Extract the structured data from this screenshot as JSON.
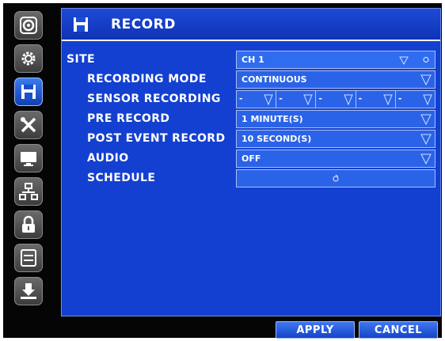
{
  "title": "RECORD",
  "sidebar": {
    "items": [
      {
        "name": "camera"
      },
      {
        "name": "gear"
      },
      {
        "name": "save"
      },
      {
        "name": "tools"
      },
      {
        "name": "monitor"
      },
      {
        "name": "network"
      },
      {
        "name": "lock"
      },
      {
        "name": "storage"
      },
      {
        "name": "download"
      }
    ],
    "active_index": 2
  },
  "form": {
    "site": {
      "label": "SITE",
      "value": "CH 1"
    },
    "recording_mode": {
      "label": "RECORDING MODE",
      "value": "CONTINUOUS"
    },
    "sensor_recording": {
      "label": "SENSOR RECORDING",
      "segments": [
        "-",
        "-",
        "-",
        "-",
        "-"
      ]
    },
    "pre_record": {
      "label": "PRE RECORD",
      "value": "1 MINUTE(S)"
    },
    "post_event_record": {
      "label": "POST EVENT RECORD",
      "value": "10 SECOND(S)"
    },
    "audio": {
      "label": "AUDIO",
      "value": "OFF"
    },
    "schedule": {
      "label": "SCHEDULE"
    }
  },
  "buttons": {
    "apply": "APPLY",
    "cancel": "CANCEL"
  },
  "colors": {
    "panel": "#1340d0",
    "field": "#2a63e8",
    "active_icon": "#1f5ae0"
  }
}
